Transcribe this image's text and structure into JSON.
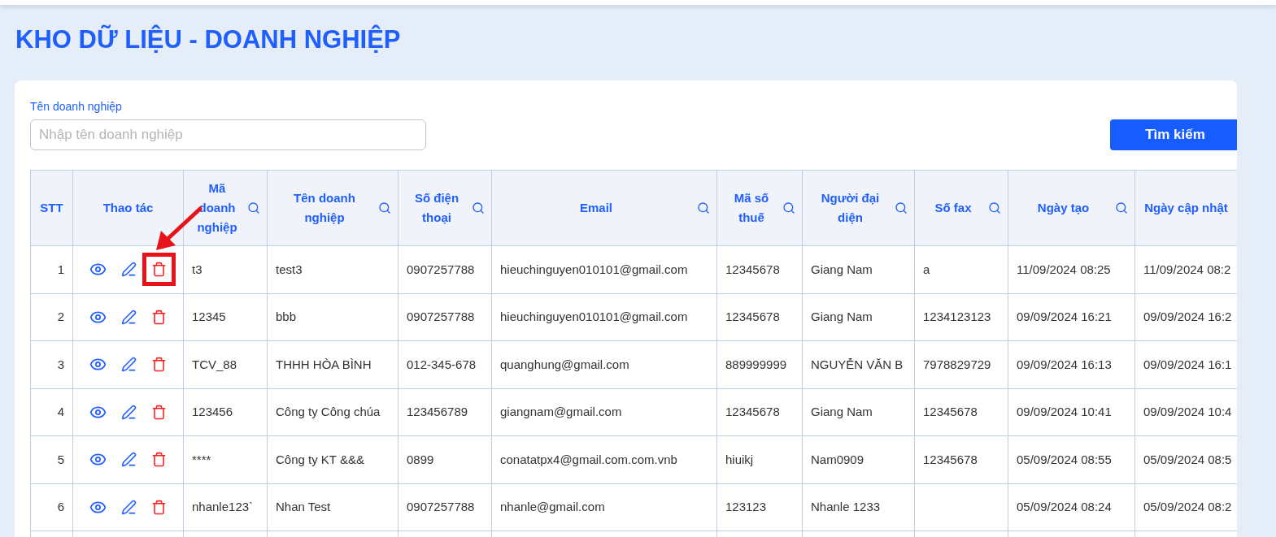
{
  "page_title": "KHO DỮ LIỆU - DOANH NGHIỆP",
  "filter": {
    "label": "Tên doanh nghiệp",
    "placeholder": "Nhập tên doanh nghiệp",
    "button": "Tìm kiếm"
  },
  "table": {
    "columns": [
      {
        "label": "STT",
        "searchable": false
      },
      {
        "label": "Thao tác",
        "searchable": false
      },
      {
        "label": "Mã doanh nghiệp",
        "searchable": true
      },
      {
        "label": "Tên doanh nghiệp",
        "searchable": true
      },
      {
        "label": "Số điện thoại",
        "searchable": true
      },
      {
        "label": "Email",
        "searchable": true
      },
      {
        "label": "Mã số thuế",
        "searchable": true
      },
      {
        "label": "Người đại diện",
        "searchable": true
      },
      {
        "label": "Số fax",
        "searchable": true
      },
      {
        "label": "Ngày tạo",
        "searchable": true
      },
      {
        "label": "Ngày cập nhật",
        "searchable": false
      }
    ],
    "rows": [
      {
        "highlighted": true,
        "cells": [
          "1",
          "",
          "t3",
          "test3",
          "0907257788",
          "hieuchinguyen010101@gmail.com",
          "12345678",
          "Giang Nam",
          "a",
          "11/09/2024 08:25",
          "11/09/2024 08:2"
        ]
      },
      {
        "highlighted": false,
        "cells": [
          "2",
          "",
          "12345",
          "bbb",
          "0907257788",
          "hieuchinguyen010101@gmail.com",
          "12345678",
          "Giang Nam",
          "1234123123",
          "09/09/2024 16:21",
          "09/09/2024 16:2"
        ]
      },
      {
        "highlighted": false,
        "cells": [
          "3",
          "",
          "TCV_88",
          "THHH HÒA BÌNH",
          "012-345-678",
          "quanghung@gmail.com",
          "889999999",
          "NGUYỄN VĂN B",
          "7978829729",
          "09/09/2024 16:13",
          "09/09/2024 16:1"
        ]
      },
      {
        "highlighted": false,
        "cells": [
          "4",
          "",
          "123456",
          "Công ty Công chúa",
          "123456789",
          "giangnam@gmail.com",
          "12345678",
          "Giang Nam",
          "12345678",
          "09/09/2024 10:41",
          "09/09/2024 10:4"
        ]
      },
      {
        "highlighted": false,
        "cells": [
          "5",
          "",
          "****",
          "Công ty KT &&&",
          "0899",
          "conatatpx4@gmail.com.com.vnb",
          "hiuikj",
          "Nam0909",
          "12345678",
          "05/09/2024 08:55",
          "05/09/2024 08:5"
        ]
      },
      {
        "highlighted": false,
        "cells": [
          "6",
          "",
          "nhanle123`",
          "Nhan Test",
          "0907257788",
          "nhanle@gmail.com",
          "123123",
          "Nhanle 1233",
          "",
          "05/09/2024 08:24",
          "05/09/2024 08:2"
        ]
      }
    ]
  }
}
